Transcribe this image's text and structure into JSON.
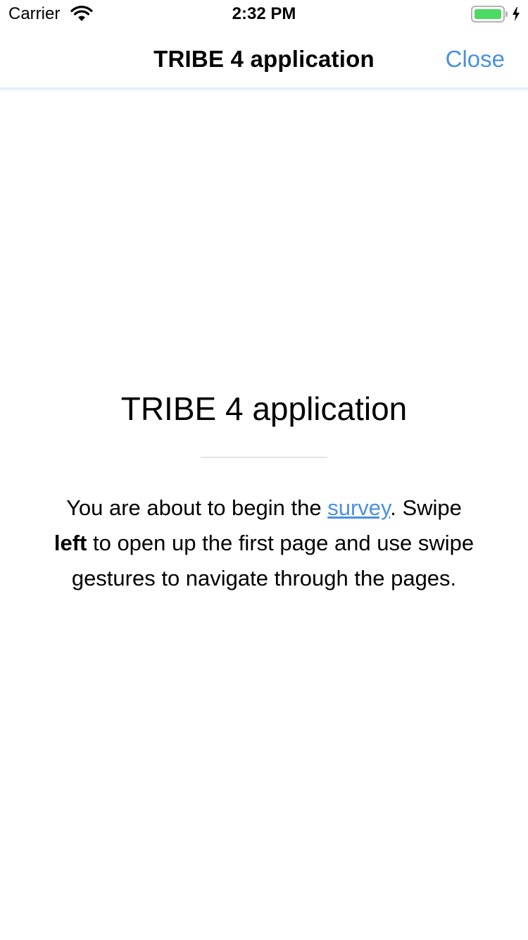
{
  "status_bar": {
    "carrier": "Carrier",
    "time": "2:32 PM",
    "battery_color": "#4cd964",
    "icons": [
      "wifi-icon",
      "battery-icon",
      "charging-icon"
    ]
  },
  "nav": {
    "title": "TRIBE 4 application",
    "close_label": "Close",
    "accent_color": "#4a90e2"
  },
  "content": {
    "title": "TRIBE 4 application",
    "intro": {
      "part1": "You are about to begin the ",
      "link_text": "survey",
      "part2": ". Swipe ",
      "bold_text": "left",
      "part3": " to open up the first page and use swipe gestures to navigate through the pages."
    }
  }
}
